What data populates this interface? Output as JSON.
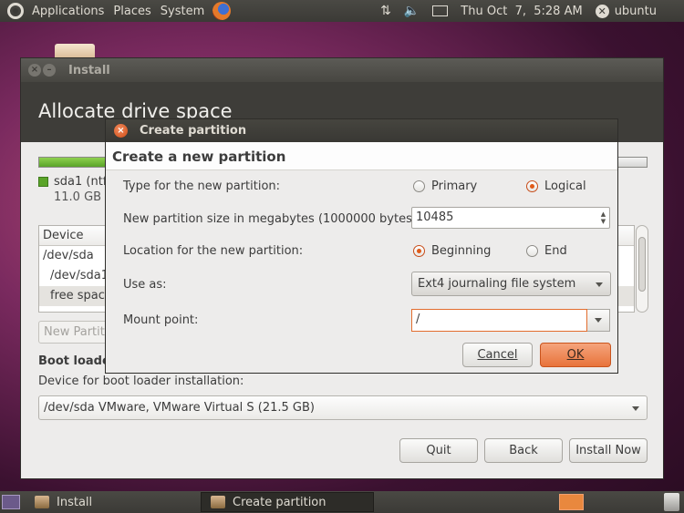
{
  "top_panel": {
    "menus": [
      "Applications",
      "Places",
      "System"
    ],
    "datetime": "Thu Oct  7,  5:28 AM",
    "user": "ubuntu",
    "icons": [
      "ubuntu-logo-icon",
      "firefox-icon",
      "network-icon",
      "volume-icon",
      "mail-icon",
      "session-icon"
    ]
  },
  "install_window": {
    "title": "Install",
    "header": "Allocate drive space",
    "legend": {
      "name": "sda1 (ntf",
      "size": "11.0 GB"
    },
    "table": {
      "header": "Device",
      "rows": [
        "/dev/sda",
        "/dev/sda1",
        "free space"
      ]
    },
    "new_partition_label": "New Partiti",
    "bootloader_title": "Boot loade",
    "bootloader_label": "Device for boot loader installation:",
    "bootloader_device": "/dev/sda VMware, VMware Virtual S (21.5 GB)",
    "buttons": {
      "quit": "Quit",
      "back": "Back",
      "install": "Install Now"
    }
  },
  "dialog": {
    "title": "Create partition",
    "heading": "Create a new partition",
    "type_label": "Type for the new partition:",
    "type_options": [
      "Primary",
      "Logical"
    ],
    "type_selected": "Logical",
    "size_label": "New partition size in megabytes (1000000 bytes):",
    "size_value": "10485",
    "location_label": "Location for the new partition:",
    "location_options": [
      "Beginning",
      "End"
    ],
    "location_selected": "Beginning",
    "use_as_label": "Use as:",
    "use_as_value": "Ext4 journaling file system",
    "mount_label": "Mount point:",
    "mount_value": "/",
    "cancel": "Cancel",
    "ok": "OK"
  },
  "taskbar": {
    "tasks": [
      "Install",
      "Create partition"
    ],
    "active_task": "Create partition"
  },
  "colors": {
    "accent": "#e8733b",
    "panel": "#3b3a36",
    "header": "#3e3d39"
  }
}
